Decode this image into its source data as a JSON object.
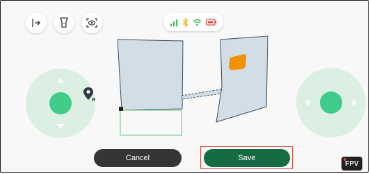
{
  "toolbar": {
    "icons": [
      "exit-icon",
      "flashlight-icon",
      "camera-eye-icon"
    ]
  },
  "status": {
    "icons": [
      "signal-icon",
      "bluetooth-icon",
      "wifi-icon",
      "battery-icon"
    ],
    "colors": {
      "signal": "#3dbb5a",
      "bluetooth": "#f2b705",
      "wifi": "#3dbb5a",
      "battery": "#d9493c"
    }
  },
  "map": {
    "icons": [
      "room-left",
      "room-right",
      "corridor",
      "pending-area",
      "obstacle-marker",
      "robot-marker"
    ],
    "colors": {
      "room_fill": "#d3dde6",
      "room_stroke": "#3c5064",
      "pending_area": "#6cc486",
      "obstacle": "#f39200"
    }
  },
  "controls": {
    "pin_label": "R",
    "cancel_label": "Cancel",
    "save_label": "Save",
    "fpv_label": "FPV"
  },
  "colors": {
    "joystick_ring": "#dcefe3",
    "joystick_knob": "#3fcb8a",
    "cancel_bg": "#353535",
    "save_bg": "#156c43",
    "highlight": "#d9493c"
  }
}
